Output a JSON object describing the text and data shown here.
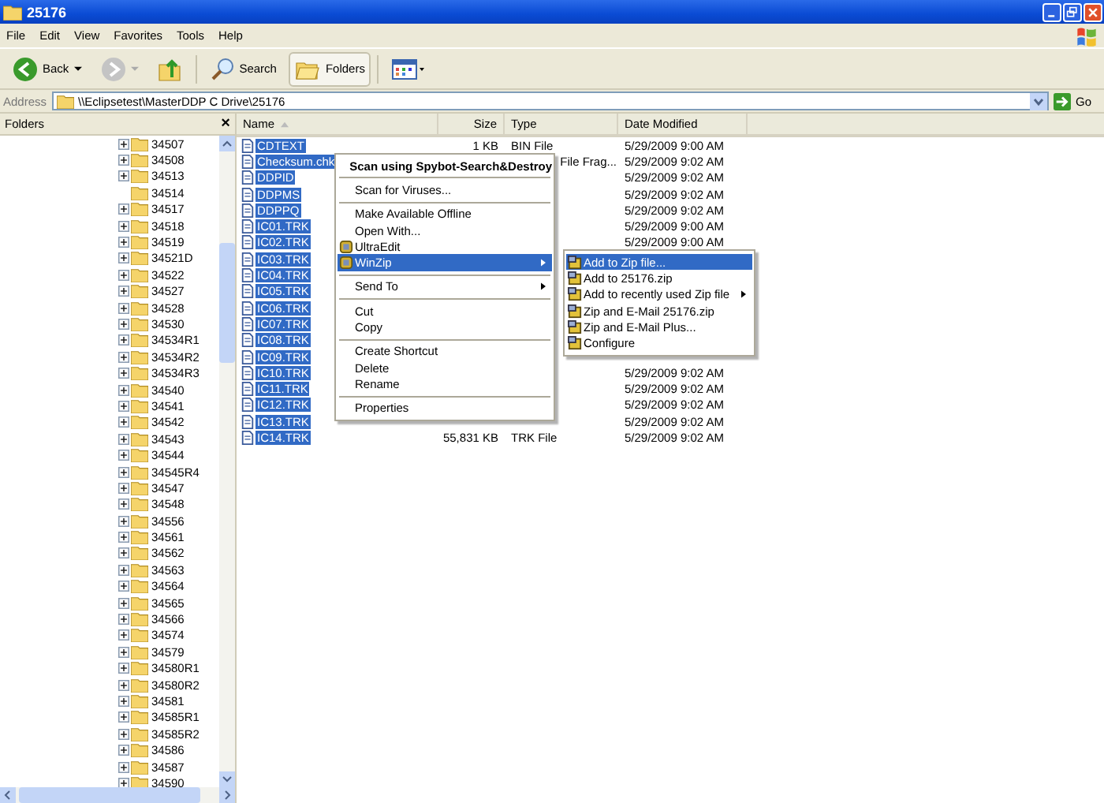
{
  "window": {
    "title": "25176"
  },
  "menu": [
    "File",
    "Edit",
    "View",
    "Favorites",
    "Tools",
    "Help"
  ],
  "toolbar": [
    {
      "kind": "back",
      "label": "Back",
      "pressed": false
    },
    {
      "kind": "forward",
      "pressed": false
    },
    {
      "kind": "up",
      "pressed": false
    },
    {
      "kind": "search",
      "label": "Search",
      "pressed": false
    },
    {
      "kind": "folders",
      "label": "Folders",
      "pressed": true
    },
    {
      "kind": "views",
      "pressed": false
    }
  ],
  "address": {
    "label": "Address",
    "value": "\\\\Eclipsetest\\MasterDDP C Drive\\25176",
    "go": "Go"
  },
  "folders_pane": {
    "title": "Folders",
    "close": "×",
    "items": [
      {
        "name": "34507",
        "expandable": true
      },
      {
        "name": "34508",
        "expandable": true
      },
      {
        "name": "34513",
        "expandable": true
      },
      {
        "name": "34514",
        "expandable": false
      },
      {
        "name": "34517",
        "expandable": true
      },
      {
        "name": "34518",
        "expandable": true
      },
      {
        "name": "34519",
        "expandable": true
      },
      {
        "name": "34521D",
        "expandable": true
      },
      {
        "name": "34522",
        "expandable": true
      },
      {
        "name": "34527",
        "expandable": true
      },
      {
        "name": "34528",
        "expandable": true
      },
      {
        "name": "34530",
        "expandable": true
      },
      {
        "name": "34534R1",
        "expandable": true
      },
      {
        "name": "34534R2",
        "expandable": true
      },
      {
        "name": "34534R3",
        "expandable": true
      },
      {
        "name": "34540",
        "expandable": true
      },
      {
        "name": "34541",
        "expandable": true
      },
      {
        "name": "34542",
        "expandable": true
      },
      {
        "name": "34543",
        "expandable": true
      },
      {
        "name": "34544",
        "expandable": true
      },
      {
        "name": "34545R4",
        "expandable": true
      },
      {
        "name": "34547",
        "expandable": true
      },
      {
        "name": "34548",
        "expandable": true
      },
      {
        "name": "34556",
        "expandable": true
      },
      {
        "name": "34561",
        "expandable": true
      },
      {
        "name": "34562",
        "expandable": true
      },
      {
        "name": "34563",
        "expandable": true
      },
      {
        "name": "34564",
        "expandable": true
      },
      {
        "name": "34565",
        "expandable": true
      },
      {
        "name": "34566",
        "expandable": true
      },
      {
        "name": "34574",
        "expandable": true
      },
      {
        "name": "34579",
        "expandable": true
      },
      {
        "name": "34580R1",
        "expandable": true
      },
      {
        "name": "34580R2",
        "expandable": true
      },
      {
        "name": "34581",
        "expandable": true
      },
      {
        "name": "34585R1",
        "expandable": true
      },
      {
        "name": "34585R2",
        "expandable": true
      },
      {
        "name": "34586",
        "expandable": true
      },
      {
        "name": "34587",
        "expandable": true
      },
      {
        "name": "34590",
        "expandable": true
      }
    ]
  },
  "file_list": {
    "columns": [
      "Name",
      "Size",
      "Type",
      "Date Modified"
    ],
    "rows": [
      {
        "name": "CDTEXT",
        "size": "1 KB",
        "type": "BIN File",
        "date": "5/29/2009 9:00 AM",
        "selected": true
      },
      {
        "name": "Checksum.chk",
        "type": "File Frag...",
        "date": "5/29/2009 9:02 AM",
        "selected": true
      },
      {
        "name": "DDPID",
        "date": "5/29/2009 9:02 AM",
        "selected": true
      },
      {
        "name": "DDPMS",
        "date": "5/29/2009 9:02 AM",
        "selected": true
      },
      {
        "name": "DDPPQ",
        "date": "5/29/2009 9:02 AM",
        "selected": true
      },
      {
        "name": "IC01.TRK",
        "date": "5/29/2009 9:00 AM",
        "selected": true
      },
      {
        "name": "IC02.TRK",
        "date": "5/29/2009 9:00 AM",
        "selected": true
      },
      {
        "name": "IC03.TRK",
        "selected": true
      },
      {
        "name": "IC04.TRK",
        "selected": true
      },
      {
        "name": "IC05.TRK",
        "selected": true
      },
      {
        "name": "IC06.TRK",
        "selected": true
      },
      {
        "name": "IC07.TRK",
        "selected": true
      },
      {
        "name": "IC08.TRK",
        "selected": true
      },
      {
        "name": "IC09.TRK",
        "selected": true
      },
      {
        "name": "IC10.TRK",
        "date": "5/29/2009 9:02 AM",
        "selected": true
      },
      {
        "name": "IC11.TRK",
        "date": "5/29/2009 9:02 AM",
        "selected": true
      },
      {
        "name": "IC12.TRK",
        "date": "5/29/2009 9:02 AM",
        "selected": true
      },
      {
        "name": "IC13.TRK",
        "date": "5/29/2009 9:02 AM",
        "selected": true
      },
      {
        "name": "IC14.TRK",
        "size": "55,831 KB",
        "type": "TRK File",
        "date": "5/29/2009 9:02 AM",
        "selected": true
      }
    ]
  },
  "context_menu": {
    "items": [
      {
        "kind": "item",
        "label": "Scan using Spybot-Search&Destroy",
        "default": true,
        "icon": false,
        "submenu": false,
        "selected": false
      },
      {
        "kind": "separator"
      },
      {
        "kind": "item",
        "label": "Scan for Viruses...",
        "default": false,
        "icon": false,
        "submenu": false,
        "selected": false
      },
      {
        "kind": "separator"
      },
      {
        "kind": "item",
        "label": "Make Available Offline",
        "default": false,
        "icon": false,
        "submenu": false,
        "selected": false
      },
      {
        "kind": "item",
        "label": "Open With...",
        "default": false,
        "icon": false,
        "submenu": false,
        "selected": false
      },
      {
        "kind": "item",
        "label": "UltraEdit",
        "default": false,
        "icon": true,
        "submenu": false,
        "selected": false
      },
      {
        "kind": "item",
        "label": "WinZip",
        "default": false,
        "icon": true,
        "submenu": true,
        "selected": true
      },
      {
        "kind": "separator"
      },
      {
        "kind": "item",
        "label": "Send To",
        "default": false,
        "icon": false,
        "submenu": true,
        "selected": false
      },
      {
        "kind": "separator"
      },
      {
        "kind": "item",
        "label": "Cut",
        "default": false,
        "icon": false,
        "submenu": false,
        "selected": false
      },
      {
        "kind": "item",
        "label": "Copy",
        "default": false,
        "icon": false,
        "submenu": false,
        "selected": false
      },
      {
        "kind": "separator"
      },
      {
        "kind": "item",
        "label": "Create Shortcut",
        "default": false,
        "icon": false,
        "submenu": false,
        "selected": false
      },
      {
        "kind": "item",
        "label": "Delete",
        "default": false,
        "icon": false,
        "submenu": false,
        "selected": false
      },
      {
        "kind": "item",
        "label": "Rename",
        "default": false,
        "icon": false,
        "submenu": false,
        "selected": false
      },
      {
        "kind": "separator"
      },
      {
        "kind": "item",
        "label": "Properties",
        "default": false,
        "icon": false,
        "submenu": false,
        "selected": false
      }
    ]
  },
  "submenu": {
    "items": [
      {
        "label": "Add to Zip file...",
        "submenu": false,
        "selected": true
      },
      {
        "label": "Add to 25176.zip",
        "submenu": false,
        "selected": false
      },
      {
        "label": "Add to recently used Zip file",
        "submenu": true,
        "selected": false
      },
      {
        "label": "Zip and E-Mail 25176.zip",
        "submenu": false,
        "selected": false
      },
      {
        "label": "Zip and E-Mail Plus...",
        "submenu": false,
        "selected": false
      },
      {
        "label": "Configure",
        "submenu": false,
        "selected": false
      }
    ]
  }
}
